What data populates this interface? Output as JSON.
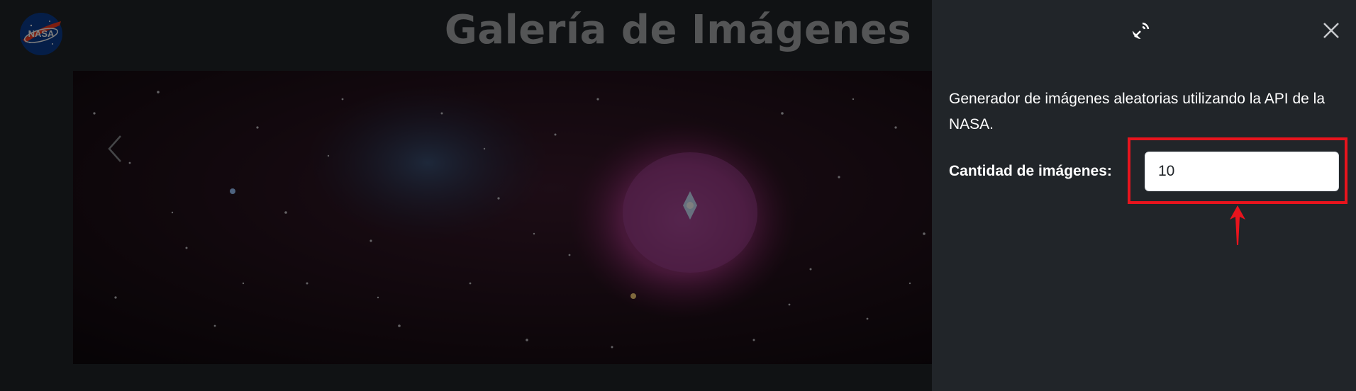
{
  "header": {
    "title": "Galería de Imágenes",
    "logo_text": "NASA",
    "logo_icon": "nasa-meatball-logo"
  },
  "carousel": {
    "prev_icon": "chevron-left-icon"
  },
  "offcanvas": {
    "header_icon": "satellite-dish-icon",
    "close_icon": "close-icon",
    "description": "Generador de imágenes aleatorias utilizando la API de la NASA.",
    "quantity_label": "Cantidad de imágenes:",
    "quantity_value": "10"
  },
  "annotation": {
    "color": "#e8141d"
  }
}
